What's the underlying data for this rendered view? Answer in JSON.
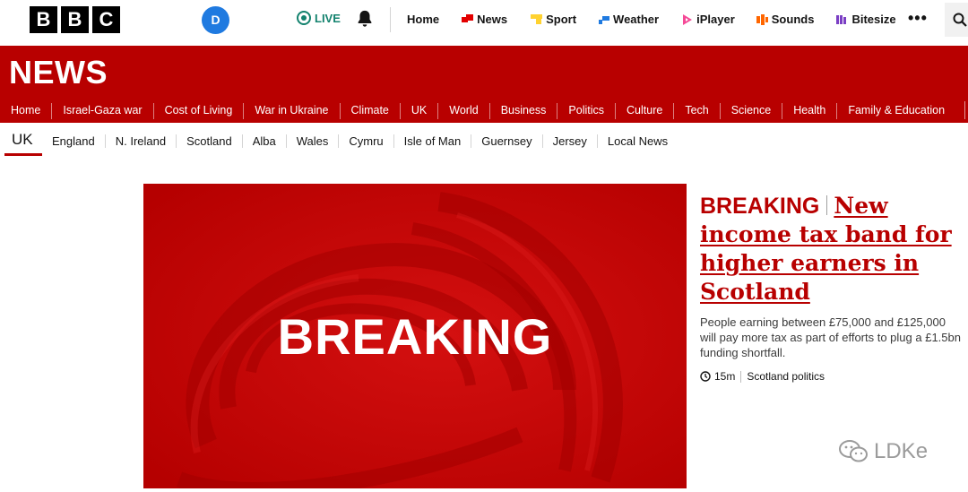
{
  "logo": {
    "letters": [
      "B",
      "B",
      "C"
    ]
  },
  "account": {
    "initial": "D"
  },
  "live": {
    "label": "LIVE",
    "color": "#13826e"
  },
  "topnav": [
    {
      "label": "Home",
      "icon": "none"
    },
    {
      "label": "News",
      "icon": "news-icon",
      "color": "#e30000"
    },
    {
      "label": "Sport",
      "icon": "sport-icon",
      "color": "#ffd230"
    },
    {
      "label": "Weather",
      "icon": "weather-icon",
      "color": "#1f7ae0"
    },
    {
      "label": "iPlayer",
      "icon": "iplayer-icon",
      "color": "#f54997"
    },
    {
      "label": "Sounds",
      "icon": "sounds-icon",
      "color": "#ff6600"
    },
    {
      "label": "Bitesize",
      "icon": "bitesize-icon",
      "color": "#7b3fc4"
    }
  ],
  "more_label": "•••",
  "masthead": {
    "title": "NEWS",
    "color": "#b80000",
    "nav": [
      "Home",
      "Israel-Gaza war",
      "Cost of Living",
      "War in Ukraine",
      "Climate",
      "UK",
      "World",
      "Business",
      "Politics",
      "Culture",
      "Tech",
      "Science",
      "Health",
      "Family & Education"
    ]
  },
  "subnav": {
    "current": "UK",
    "items": [
      "England",
      "N. Ireland",
      "Scotland",
      "Alba",
      "Wales",
      "Cymru",
      "Isle of Man",
      "Guernsey",
      "Jersey",
      "Local News"
    ]
  },
  "hero": {
    "image_text": "BREAKING",
    "label": "BREAKING",
    "headline": "New income tax band for higher earners in Scotland",
    "summary": "People earning between £75,000 and £125,000 will pay more tax as part of efforts to plug a £1.5bn funding shortfall.",
    "time": "15m",
    "topic": "Scotland politics"
  },
  "watermark": {
    "text": "LDKe"
  }
}
